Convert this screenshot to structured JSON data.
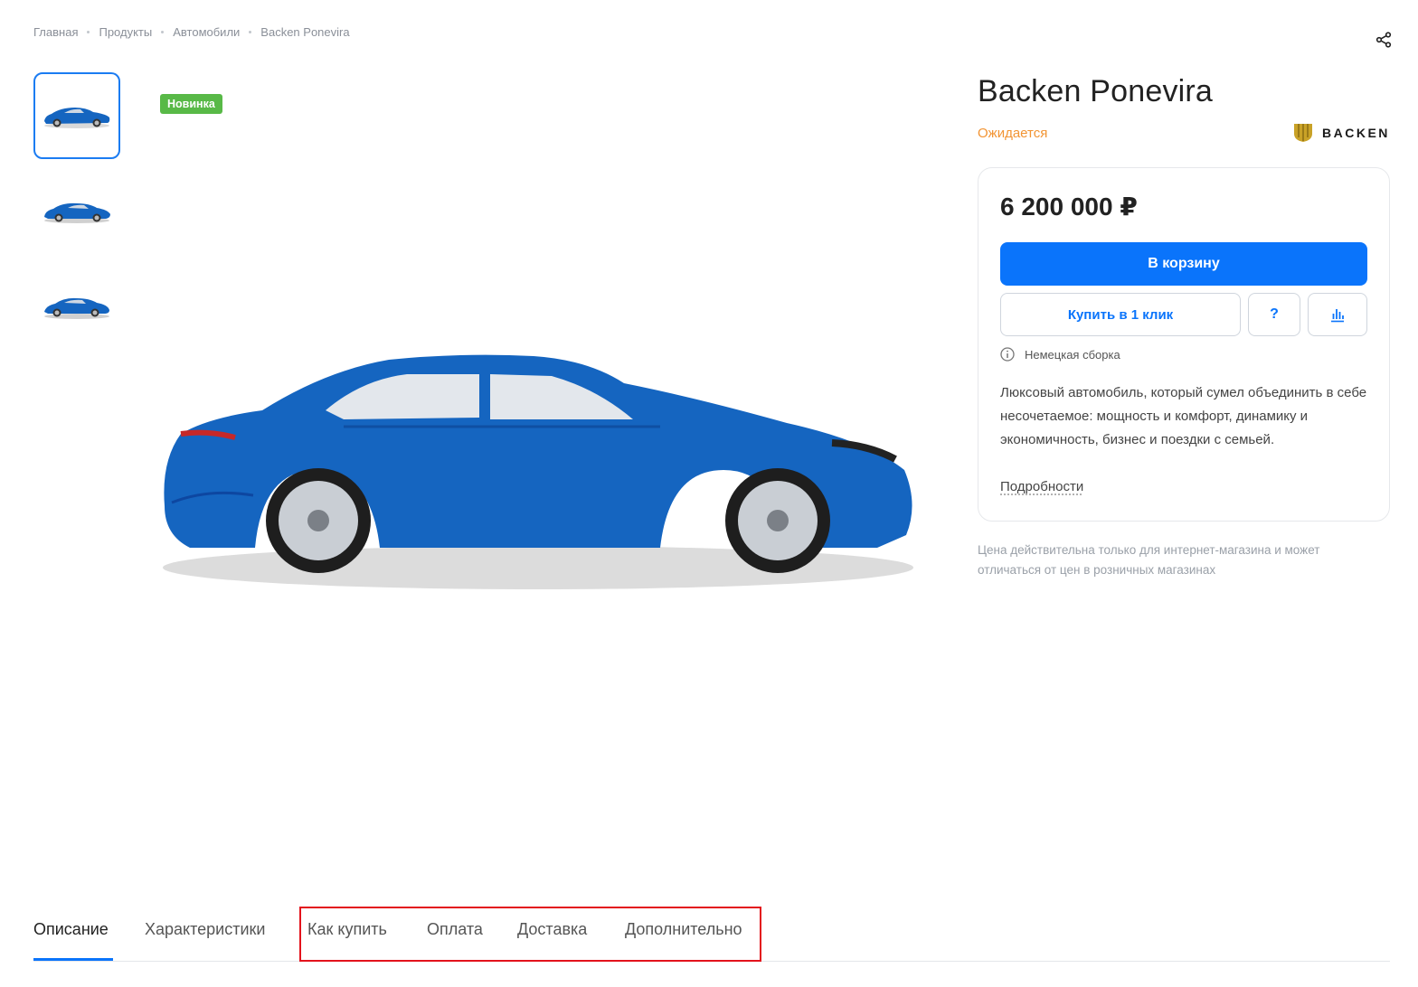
{
  "breadcrumb": [
    "Главная",
    "Продукты",
    "Автомобили",
    "Backen Ponevira"
  ],
  "badge": "Новинка",
  "product": {
    "title": "Backen Ponevira",
    "availability": "Ожидается",
    "brand": "BACKEN",
    "price": "6 200 000 ₽",
    "assembly": "Немецкая сборка",
    "description": "Люксовый автомобиль, который сумел объединить в себе несочетаемое: мощность и комфорт, динамику и экономичность, бизнес и поездки с семьей.",
    "more_link": "Подробности"
  },
  "buttons": {
    "cart": "В корзину",
    "one_click": "Купить в 1 клик",
    "question": "?"
  },
  "price_note": "Цена действительна только для интернет-магазина и может отличаться от цен в розничных магазинах",
  "tabs": [
    "Описание",
    "Характеристики",
    "Как купить",
    "Оплата",
    "Доставка",
    "Дополнительно"
  ],
  "colors": {
    "accent": "#0a74fb",
    "badge": "#58b947",
    "availability": "#f29433",
    "car": "#1565c0",
    "highlight": "#e3131c"
  },
  "icons": [
    "share-icon",
    "info-icon",
    "chart-icon",
    "question-icon"
  ]
}
